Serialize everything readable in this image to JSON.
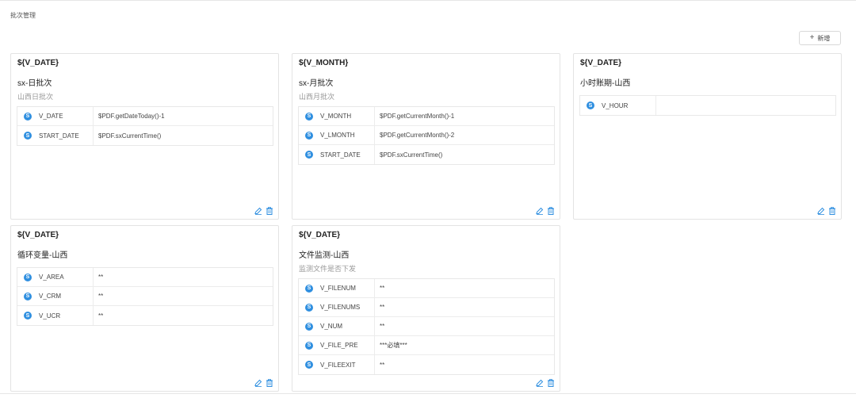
{
  "page": {
    "title": "批次管理"
  },
  "toolbar": {
    "add_icon": "+",
    "add_label": "新增"
  },
  "icons": {
    "param": "S",
    "edit": "edit-icon",
    "delete": "trash-icon",
    "accent": "#2f8fe0"
  },
  "cards": [
    {
      "var": "${V_DATE}",
      "name": "sx-日批次",
      "desc": "山西日批次",
      "params": [
        {
          "name": "V_DATE",
          "value": "$PDF.getDateToday()-1"
        },
        {
          "name": "START_DATE",
          "value": "$PDF.sxCurrentTime()"
        }
      ]
    },
    {
      "var": "${V_MONTH}",
      "name": "sx-月批次",
      "desc": "山西月批次",
      "params": [
        {
          "name": "V_MONTH",
          "value": "$PDF.getCurrentMonth()-1"
        },
        {
          "name": "V_LMONTH",
          "value": "$PDF.getCurrentMonth()-2"
        },
        {
          "name": "START_DATE",
          "value": "$PDF.sxCurrentTime()"
        }
      ]
    },
    {
      "var": "${V_DATE}",
      "name": "小时账期-山西",
      "desc": "",
      "params": [
        {
          "name": "V_HOUR",
          "value": ""
        }
      ]
    },
    {
      "var": "${V_DATE}",
      "name": "循环变量-山西",
      "desc": "",
      "params": [
        {
          "name": "V_AREA",
          "value": "**"
        },
        {
          "name": "V_CRM",
          "value": "**"
        },
        {
          "name": "V_UCR",
          "value": "**"
        }
      ]
    },
    {
      "var": "${V_DATE}",
      "name": "文件监测-山西",
      "desc": "监测文件是否下发",
      "params": [
        {
          "name": "V_FILENUM",
          "value": "**"
        },
        {
          "name": "V_FILENUMS",
          "value": "**"
        },
        {
          "name": "V_NUM",
          "value": "**"
        },
        {
          "name": "V_FILE_PRE",
          "value": "***必填***"
        },
        {
          "name": "V_FILEEXIT",
          "value": "**"
        }
      ]
    }
  ]
}
